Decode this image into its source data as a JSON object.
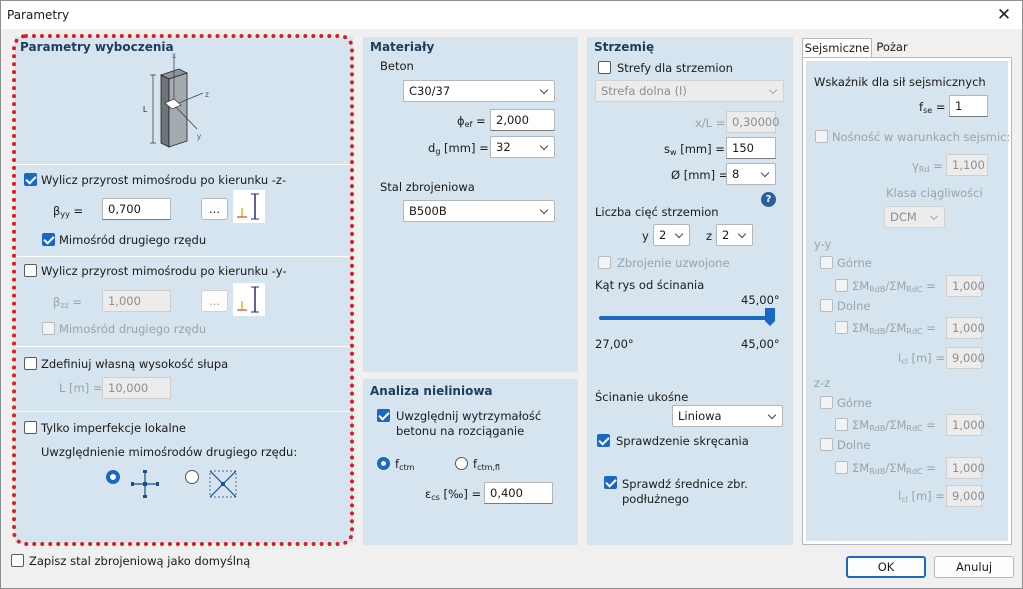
{
  "window": {
    "title": "Parametry"
  },
  "buckling": {
    "title": "Parametry wyboczenia",
    "z_section": {
      "label": "Wylicz przyrost mimośrodu po kierunku -z-",
      "checked": true,
      "beta_label": "β",
      "beta_sub": "yy",
      "beta_value": "0,700",
      "more_button": "...",
      "second_order_label": "Mimośród drugiego rzędu",
      "second_order_checked": true
    },
    "y_section": {
      "label": "Wylicz przyrost mimośrodu po kierunku -y-",
      "checked": false,
      "beta_label": "β",
      "beta_sub": "zz",
      "beta_value": "1,000",
      "more_button": "...",
      "second_order_label": "Mimośród drugiego rzędu",
      "second_order_checked": false
    },
    "height": {
      "label": "Zdefiniuj własną wysokość słupa",
      "checked": false,
      "field_label": "L [m] =",
      "value": "10,000"
    },
    "local": {
      "label": "Tylko imperfekcje lokalne",
      "checked": false,
      "note": "Uwzględnienie mimośrodów drugiego rzędu:"
    },
    "diagram_labels": {
      "x": "x",
      "l": "L",
      "z": "z",
      "y": "y"
    }
  },
  "materials": {
    "title": "Materiały",
    "concrete_label": "Beton",
    "concrete_value": "C30/37",
    "phi_label": "ϕ",
    "phi_sub": "ef",
    "phi_eq": "=",
    "phi_value": "2,000",
    "dg_label": "d",
    "dg_sub": "g",
    "dg_unit": "[mm] =",
    "dg_value": "32",
    "steel_label": "Stal zbrojeniowa",
    "steel_value": "B500B"
  },
  "nonlinear": {
    "title": "Analiza nieliniowa",
    "tension_label_1": "Uwzględnij wytrzymałość",
    "tension_label_2": "betonu na rozciąganie",
    "tension_checked": true,
    "fctm_main": "f",
    "fctm_sub": "ctm",
    "fctmfl_main": "f",
    "fctmfl_sub": "ctm,fl",
    "eps_label": "ε",
    "eps_sub": "cs",
    "eps_unit": "[‰] =",
    "eps_value": "0,400"
  },
  "stirrup": {
    "title": "Strzemię",
    "zones_label": "Strefy dla strzemion",
    "zones_checked": false,
    "zone_value": "Strefa dolna (l)",
    "xl_label": "x/L =",
    "xl_value": "0,30000",
    "sw_label": "s",
    "sw_sub": "w",
    "sw_unit": "[mm] =",
    "sw_value": "150",
    "dia_label": "Ø [mm] =",
    "dia_value": "8",
    "help": "?",
    "cuts_label": "Liczba cięć strzemion",
    "y_label": "y",
    "y_value": "2",
    "z_label": "z",
    "z_value": "2",
    "reinforced_label": "Zbrojenie uzwojone",
    "angle_label": "Kąt rys od ścinania",
    "angle_value": "45,00°",
    "angle_min": "27,00°",
    "angle_max": "45,00°",
    "angle_fraction": 1.0,
    "oblique_label": "Ścinanie ukośne",
    "oblique_value": "Liniowa",
    "torsion_label": "Sprawdzenie skręcania",
    "torsion_checked": true,
    "diam_check_1": "Sprawdź średnice zbr.",
    "diam_check_2": "podłużnego",
    "diam_check_checked": true
  },
  "seismic": {
    "tabs": [
      "Sejsmiczne",
      "Pożar"
    ],
    "factor_label": "Wskaźnik dla sił sejsmicznych",
    "fse_main": "f",
    "fse_sub": "se",
    "fse_eq": "=",
    "fse_value": "1",
    "capacity_label": "Nośność w warunkach sejsmic:",
    "grd_main": "γ",
    "grd_sub": "Rd",
    "grd_eq": "=",
    "grd_value": "1,100",
    "ductility_label": "Klasa ciągliwości",
    "ductility_value": "DCM",
    "yy_label": "y-y",
    "zz_label": "z-z",
    "top_label": "Górne",
    "bottom_label": "Dolne",
    "ratio_main": "ΣM",
    "ratio_sub1": "RdB",
    "ratio_mid": "/ΣM",
    "ratio_sub2": "RdC",
    "ratio_eq": "=",
    "lcl_main": "l",
    "lcl_sub": "cl",
    "lcl_unit": "[m] =",
    "yy_top_ratio": "1,000",
    "yy_bottom_ratio": "1,000",
    "yy_lcl": "9,000",
    "zz_top_ratio": "1,000",
    "zz_bottom_ratio": "1,000",
    "zz_lcl": "9,000"
  },
  "footer": {
    "save_default_label": "Zapisz stal zbrojeniową jako domyślną",
    "ok": "OK",
    "cancel": "Anuluj"
  },
  "colors": {
    "accent": "#1a67c4",
    "panel": "#d5e4ef",
    "highlight": "#e01b1b"
  }
}
